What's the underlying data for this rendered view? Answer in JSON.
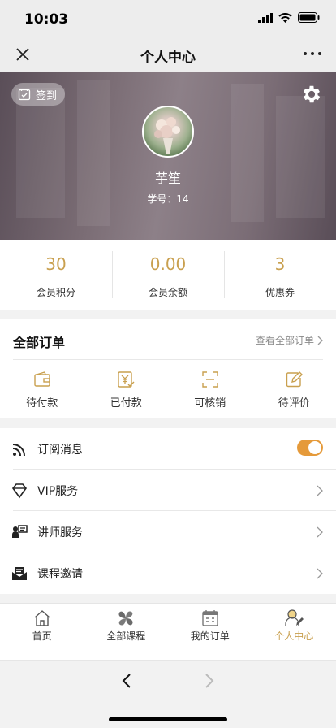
{
  "status_bar": {
    "time": "10:03"
  },
  "nav": {
    "title": "个人中心"
  },
  "profile": {
    "checkin_label": "签到",
    "name": "芋笙",
    "id_label": "学号：",
    "id_value": "14"
  },
  "stats": [
    {
      "value": "30",
      "label": "会员积分"
    },
    {
      "value": "0.00",
      "label": "会员余额"
    },
    {
      "value": "3",
      "label": "优惠券"
    }
  ],
  "orders": {
    "title": "全部订单",
    "view_all": "查看全部订单",
    "items": [
      {
        "label": "待付款",
        "icon": "wallet-icon"
      },
      {
        "label": "已付款",
        "icon": "paid-yen-icon"
      },
      {
        "label": "可核销",
        "icon": "scan-icon"
      },
      {
        "label": "待评价",
        "icon": "review-edit-icon"
      }
    ]
  },
  "menu": {
    "items": [
      {
        "label": "订阅消息",
        "icon": "rss-icon",
        "toggle_on": true
      },
      {
        "label": "VIP服务",
        "icon": "diamond-icon"
      },
      {
        "label": "讲师服务",
        "icon": "lecturer-icon"
      },
      {
        "label": "课程邀请",
        "icon": "invite-envelope-icon"
      }
    ]
  },
  "tabbar": {
    "items": [
      {
        "label": "首页",
        "icon": "home-icon"
      },
      {
        "label": "全部课程",
        "icon": "courses-icon"
      },
      {
        "label": "我的订单",
        "icon": "orders-calendar-icon"
      },
      {
        "label": "个人中心",
        "icon": "profile-icon",
        "active": true
      }
    ]
  },
  "colors": {
    "accent": "#c9a04f",
    "toggle": "#e59a3a"
  }
}
